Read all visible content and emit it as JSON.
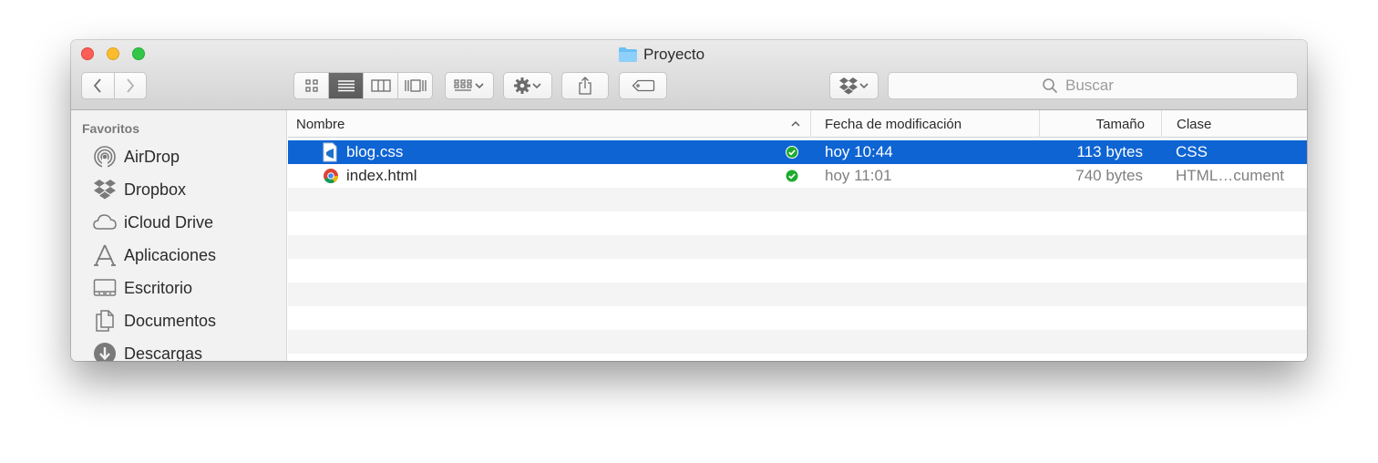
{
  "window": {
    "title": "Proyecto"
  },
  "toolbar": {
    "search_placeholder": "Buscar"
  },
  "sidebar": {
    "section_title": "Favoritos",
    "items": [
      {
        "label": "AirDrop",
        "icon": "airdrop-icon"
      },
      {
        "label": "Dropbox",
        "icon": "dropbox-icon"
      },
      {
        "label": "iCloud Drive",
        "icon": "cloud-icon"
      },
      {
        "label": "Aplicaciones",
        "icon": "applications-icon"
      },
      {
        "label": "Escritorio",
        "icon": "desktop-icon"
      },
      {
        "label": "Documentos",
        "icon": "documents-icon"
      },
      {
        "label": "Descargas",
        "icon": "downloads-icon"
      }
    ]
  },
  "table": {
    "columns": {
      "name": "Nombre",
      "modified": "Fecha de modificación",
      "size": "Tamaño",
      "kind": "Clase"
    },
    "rows": [
      {
        "name": "blog.css",
        "modified": "hoy 10:44",
        "size": "113 bytes",
        "kind": "CSS",
        "selected": true
      },
      {
        "name": "index.html",
        "modified": "hoy 11:01",
        "size": "740 bytes",
        "kind": "HTML…cument",
        "selected": false
      }
    ]
  },
  "colors": {
    "selection": "#0e64d3",
    "sync_badge": "#1faa2f"
  }
}
